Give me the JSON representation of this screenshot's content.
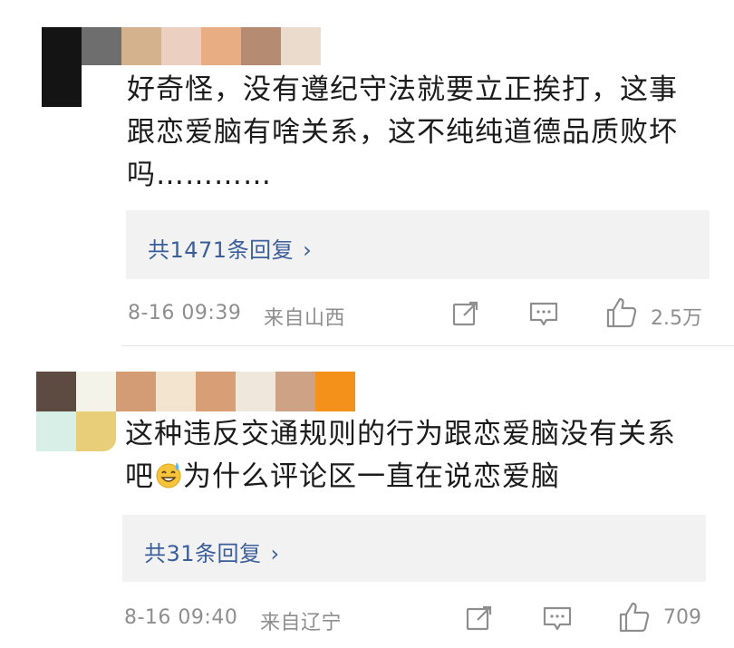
{
  "comments": [
    {
      "avatar_colors": [
        "#1a1a1a",
        "#707070",
        "#d2b28c",
        "#ead0c0",
        "#e7ae83",
        "#b68c72",
        "#eadccd"
      ],
      "text_lines": [
        "好奇怪，没有遵纪守法就要立正挨打，这事",
        "跟恋爱脑有啥关系，这不纯纯道德品质败坏",
        "吗…………"
      ],
      "reply_label": "共1471条回复",
      "reply_chevron": "›",
      "time": "8-16 09:39",
      "location": "来自山西",
      "share_icon": "share-icon",
      "comment_icon": "comment-icon",
      "like_icon": "thumbs-up-icon",
      "like_count": "2.5万"
    },
    {
      "avatar_colors": [
        "#5e4b42",
        "#f3f2ea",
        "#d39d76",
        "#f3e5d0",
        "#d9a077",
        "#efe7dd",
        "#cfa486",
        "#f2921c",
        "#d8f0e8",
        "#e8cf7b"
      ],
      "text_line1": "这种违反交通规则的行为跟恋爱脑没有关系",
      "text_line2_a": "吧",
      "emoji": "sweat-smile-emoji",
      "text_line2_b": "为什么评论区一直在说恋爱脑",
      "reply_label": "共31条回复",
      "reply_chevron": "›",
      "time": "8-16 09:40",
      "location": "来自辽宁",
      "share_icon": "share-icon",
      "comment_icon": "comment-icon",
      "like_icon": "thumbs-up-icon",
      "like_count": "709"
    }
  ],
  "colors": {
    "text": "#1b1b1b",
    "meta": "#8e8e8e",
    "link": "#3a5e9a",
    "reply_bg": "#f2f2f2"
  }
}
